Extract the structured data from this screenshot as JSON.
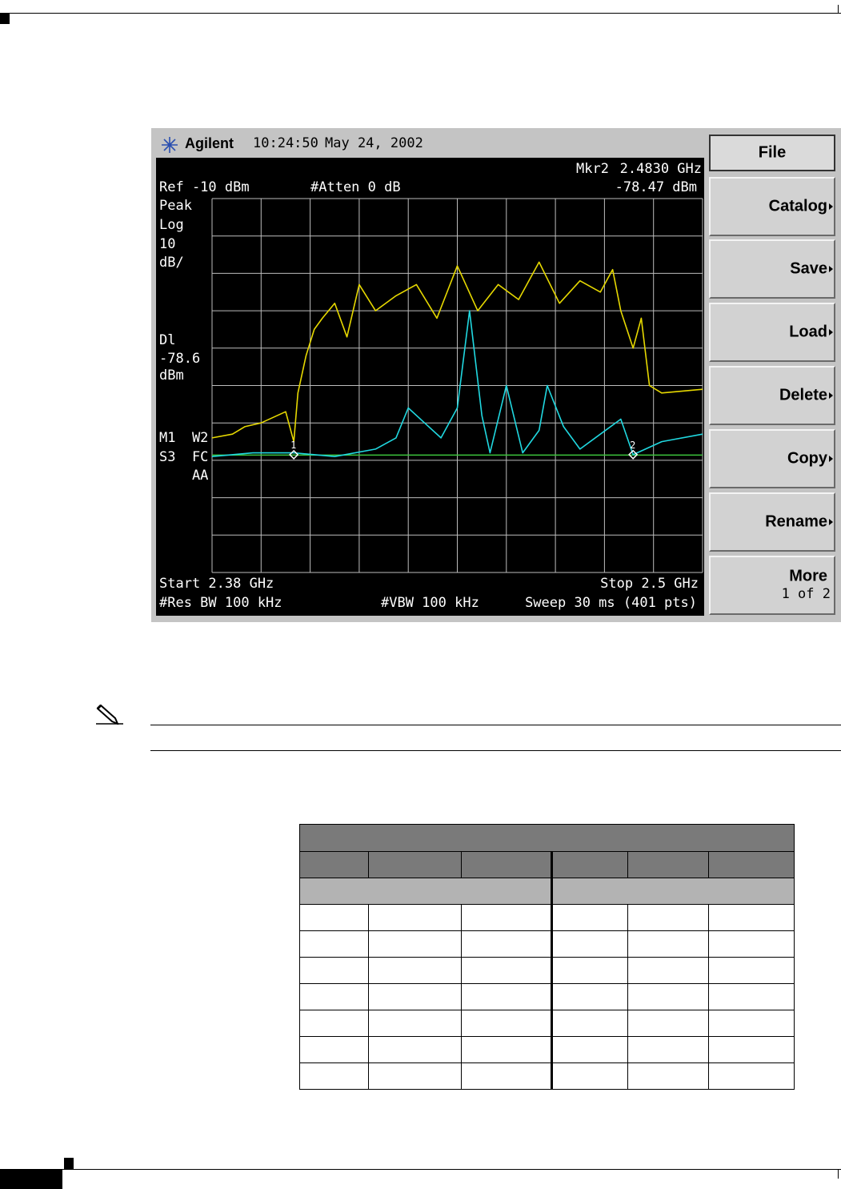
{
  "instrument": {
    "brand": "Agilent",
    "time": "10:24:50",
    "date": "May 24, 2002",
    "marker_readout": {
      "label": "Mkr2",
      "frequency": "2.4830 GHz",
      "level": "-78.47 dBm"
    },
    "ref_level": "Ref -10 dBm",
    "attenuation": "#Atten 0 dB",
    "left_annotations": [
      "Peak",
      "Log",
      "10",
      "dB/"
    ],
    "display_line": [
      "Dl",
      "-78.6",
      "dBm"
    ],
    "trace_annotations": [
      "M1  W2",
      "S3  FC",
      "    AA"
    ],
    "start": "Start 2.38 GHz",
    "stop": "Stop 2.5 GHz",
    "res_bw": "#Res BW 100 kHz",
    "vbw": "#VBW 100 kHz",
    "sweep": "Sweep 30 ms (401 pts)",
    "marker_labels": [
      "1",
      "2"
    ],
    "softkeys": [
      {
        "label": "File",
        "arrow": false
      },
      {
        "label": "Catalog",
        "arrow": true
      },
      {
        "label": "Save",
        "arrow": true
      },
      {
        "label": "Load",
        "arrow": true
      },
      {
        "label": "Delete",
        "arrow": true
      },
      {
        "label": "Copy",
        "arrow": true
      },
      {
        "label": "Rename",
        "arrow": true
      },
      {
        "label": "More",
        "sub": "1 of 2",
        "arrow": false
      }
    ]
  },
  "chart_data": {
    "type": "line",
    "x_range_ghz": [
      2.38,
      2.5
    ],
    "ylim_dbm": [
      -110,
      -10
    ],
    "y_scale_db_per_div": 10,
    "grid": true,
    "display_line_dbm": -78.6,
    "markers": [
      {
        "name": "1",
        "x_ghz": 2.4,
        "y_dbm": -78.5
      },
      {
        "name": "2",
        "x_ghz": 2.483,
        "y_dbm": -78.47
      }
    ],
    "series": [
      {
        "color": "#e6d800",
        "x_ghz": [
          2.38,
          2.385,
          2.388,
          2.392,
          2.398,
          2.4,
          2.401,
          2.403,
          2.405,
          2.407,
          2.41,
          2.413,
          2.416,
          2.42,
          2.425,
          2.43,
          2.435,
          2.44,
          2.445,
          2.45,
          2.455,
          2.46,
          2.465,
          2.47,
          2.475,
          2.478,
          2.48,
          2.483,
          2.485,
          2.487,
          2.49,
          2.5
        ],
        "y_dbm": [
          -74,
          -73,
          -71,
          -70,
          -67,
          -75,
          -62,
          -52,
          -45,
          -42,
          -38,
          -47,
          -33,
          -40,
          -36,
          -33,
          -42,
          -28,
          -40,
          -33,
          -37,
          -27,
          -38,
          -32,
          -35,
          -29,
          -40,
          -50,
          -42,
          -60,
          -62,
          -61
        ]
      },
      {
        "color": "#20d8e0",
        "x_ghz": [
          2.38,
          2.39,
          2.4,
          2.41,
          2.42,
          2.425,
          2.428,
          2.432,
          2.436,
          2.44,
          2.443,
          2.446,
          2.448,
          2.452,
          2.456,
          2.46,
          2.462,
          2.466,
          2.47,
          2.475,
          2.48,
          2.483,
          2.49,
          2.5
        ],
        "y_dbm": [
          -79,
          -78,
          -78,
          -79,
          -77,
          -74,
          -66,
          -70,
          -74,
          -66,
          -40,
          -68,
          -78,
          -60,
          -78,
          -72,
          -60,
          -71,
          -77,
          -73,
          -69,
          -78.5,
          -75,
          -73
        ]
      }
    ]
  },
  "note_icon": "pencil-note-icon",
  "table": {
    "columns": 6,
    "data_rows": 7
  }
}
